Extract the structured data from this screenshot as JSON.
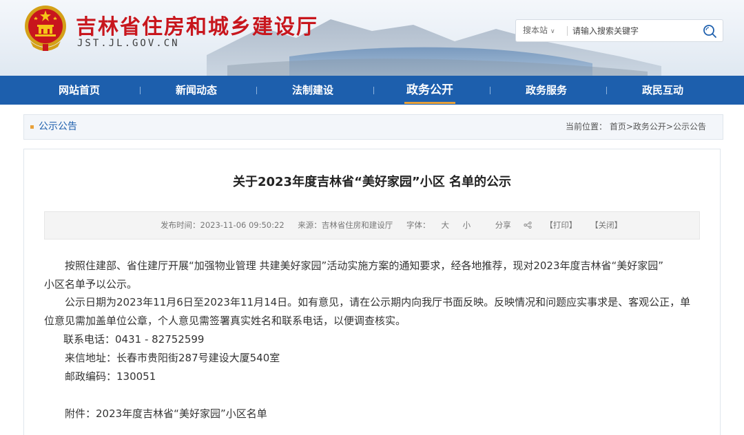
{
  "header": {
    "site_title": "吉林省住房和城乡建设厅",
    "domain": "JST.JL.GOV.CN",
    "search": {
      "scope_label": "搜本站",
      "placeholder": "请输入搜索关键字"
    }
  },
  "nav": {
    "items": [
      {
        "label": "网站首页"
      },
      {
        "label": "新闻动态"
      },
      {
        "label": "法制建设"
      },
      {
        "label": "政务公开"
      },
      {
        "label": "政务服务"
      },
      {
        "label": "政民互动"
      }
    ],
    "active_index": 3
  },
  "breadcrumb": {
    "section_title": "公示公告",
    "prefix": "当前位置：",
    "path": [
      "首页",
      "政务公开",
      "公示公告"
    ],
    "separator": ">"
  },
  "article": {
    "title": "关于2023年度吉林省“美好家园”小区 名单的公示",
    "meta": {
      "publish_label": "发布时间：2023-11-06 09:50:22",
      "source_label": "来源：吉林省住房和建设厅",
      "font_label": "字体：",
      "font_large": "大",
      "font_small": "小",
      "share_label": "分享",
      "print_label": "【打印】",
      "close_label": "【关闭】"
    },
    "paragraphs": {
      "p1_line1": "按照住建部、省住建厅开展“加强物业管理 共建美好家园”活动实施方案的通知要求，经各地推荐，现对2023年度吉林省“美好家园”",
      "p1_line2": "小区名单予以公示。",
      "p2_line1": "公示日期为2023年11月6日至2023年11月14日。如有意见，请在公示期内向我厅书面反映。反映情况和问题应实事求是、客观公正，单",
      "p2_line2": "位意见需加盖单位公章，个人意见需签署真实姓名和联系电话，以便调查核实。",
      "phone": "联系电话：0431 - 82752599",
      "address": "来信地址：长春市贵阳街287号建设大厦540室",
      "postcode": "邮政编码：130051",
      "attachment": "附件：2023年度吉林省“美好家园”小区名单"
    }
  },
  "colors": {
    "nav_bg": "#1d5fad",
    "title_red": "#c8161d",
    "accent_orange": "#e8a13a"
  },
  "icons": {
    "emblem": "national-emblem-icon",
    "search": "search-icon",
    "share": "share-icon",
    "dropdown": "chevron-down-icon"
  }
}
